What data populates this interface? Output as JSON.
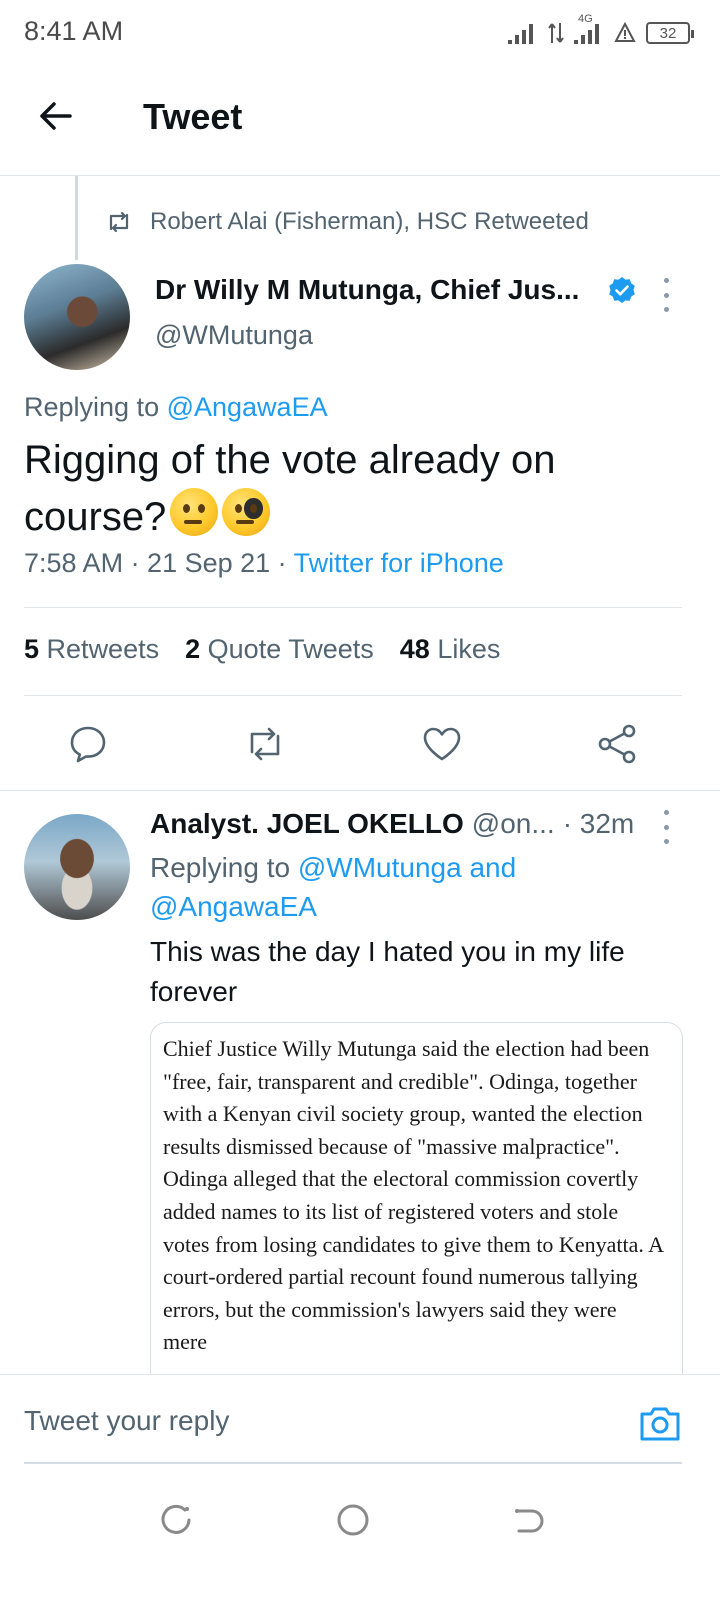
{
  "status_bar": {
    "time": "8:41 AM",
    "network_label": "4G",
    "battery": "32",
    "icons": [
      "signal-icon",
      "data-arrows-icon",
      "signal-4g-icon",
      "alert-icon",
      "battery-icon"
    ]
  },
  "header": {
    "title": "Tweet",
    "back_icon": "back-arrow-icon"
  },
  "main_tweet": {
    "retweet_context": "Robert Alai (Fisherman), HSC Retweeted",
    "author_name": "Dr Willy M Mutunga, Chief Jus...",
    "author_handle": "@WMutunga",
    "verified": true,
    "replying_prefix": "Replying to ",
    "replying_to": "@AngawaEA",
    "text": "Rigging of the vote already on course?",
    "emojis": [
      "thinking-face",
      "face-with-monocle"
    ],
    "time": "7:58 AM · 21 Sep 21 · ",
    "source": "Twitter for iPhone",
    "stats": {
      "retweets_count": "5",
      "retweets_label": "Retweets",
      "quotes_count": "2",
      "quotes_label": "Quote Tweets",
      "likes_count": "48",
      "likes_label": "Likes"
    },
    "actions": [
      "reply-icon",
      "retweet-icon",
      "like-icon",
      "share-icon"
    ]
  },
  "reply_tweet": {
    "author_name": "Analyst. JOEL OKELLO",
    "author_handle": "@on...",
    "time": "· 32m",
    "replying_prefix": "Replying to ",
    "replying_to_1": "@WMutunga",
    "replying_and": " and",
    "replying_to_2": "@AngawaEA",
    "text": "This was the day I hated you in my life forever",
    "quote_text": "Chief Justice Willy Mutunga said the election had been \"free, fair, transparent and credible\". Odinga, together with a Kenyan civil society group, wanted the election results dismissed because of \"massive malpractice\". Odinga alleged that the electoral commission covertly added names to its list of registered voters and stole votes from losing candidates to give them to Kenyatta. A court-ordered partial recount found numerous tallying errors, but the commission's lawyers said they were mere"
  },
  "composer": {
    "placeholder": "Tweet your reply",
    "camera_icon": "camera-icon"
  },
  "nav_bar": {
    "buttons": [
      "recents-icon",
      "home-icon",
      "back-icon"
    ]
  },
  "colors": {
    "accent": "#1d9bf0",
    "text_primary": "#0f1419",
    "text_secondary": "#536471",
    "divider": "#e1e6ea"
  }
}
